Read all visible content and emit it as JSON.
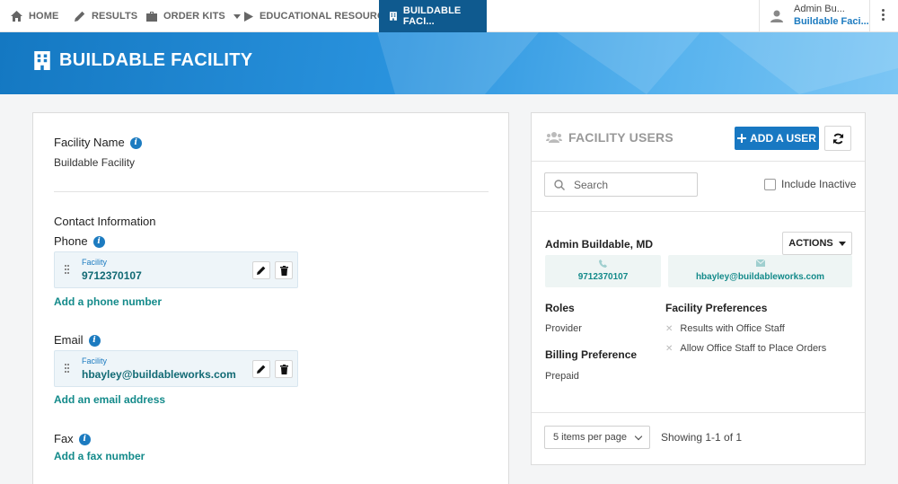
{
  "nav": {
    "items": [
      {
        "label": "HOME",
        "icon": "home-icon"
      },
      {
        "label": "RESULTS",
        "icon": "pencil-icon"
      },
      {
        "label": "ORDER KITS",
        "icon": "briefcase-icon"
      },
      {
        "label": "EDUCATIONAL RESOURCES",
        "icon": "play-icon"
      },
      {
        "label": "BUILDABLE FACI...",
        "icon": "building-icon"
      }
    ],
    "user": {
      "name": "Admin Bu...",
      "facility": "Buildable Faci..."
    }
  },
  "banner": {
    "title": "BUILDABLE FACILITY"
  },
  "facility": {
    "name_label": "Facility Name",
    "name_value": "Buildable Facility",
    "contact_heading": "Contact Information",
    "phone": {
      "label": "Phone",
      "type": "Facility",
      "value": "9712370107",
      "add_link": "Add a phone number"
    },
    "email": {
      "label": "Email",
      "type": "Facility",
      "value": "hbayley@buildableworks.com",
      "add_link": "Add an email address"
    },
    "fax": {
      "label": "Fax",
      "add_link": "Add a fax number"
    }
  },
  "users": {
    "title": "FACILITY USERS",
    "add_button": "ADD A USER",
    "search_placeholder": "Search",
    "include_inactive": "Include Inactive",
    "user": {
      "name": "Admin Buildable, MD",
      "actions": "ACTIONS",
      "phone": "9712370107",
      "email": "hbayley@buildableworks.com",
      "roles_label": "Roles",
      "role": "Provider",
      "billing_label": "Billing Preference",
      "billing": "Prepaid",
      "prefs_label": "Facility Preferences",
      "prefs": [
        "Results with Office Staff",
        "Allow Office Staff to Place Orders"
      ]
    },
    "pager": {
      "per_page": "5 items per page",
      "showing": "Showing 1-1 of 1"
    }
  },
  "colors": {
    "brand": "#1878c2",
    "active_tab": "#0f5a8f",
    "link": "#138a8a"
  }
}
